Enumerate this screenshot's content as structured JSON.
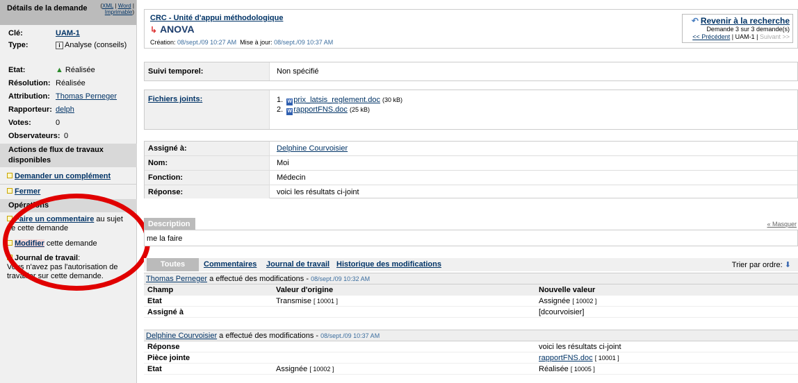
{
  "sidebar": {
    "title": "Détails de la demande",
    "formats": {
      "xml": "XML",
      "word": "Word",
      "printable": "Imprimable"
    },
    "fields": [
      {
        "key": "Clé:",
        "value": "UAM-1"
      },
      {
        "key": "Type:",
        "value": "Analyse (conseils)"
      },
      {
        "key": "Etat:",
        "value": "Réalisée"
      },
      {
        "key": "Résolution:",
        "value": "Réalisée"
      },
      {
        "key": "Attribution:",
        "value": "Thomas Perneger"
      },
      {
        "key": "Rapporteur:",
        "value": "delph"
      },
      {
        "key": "Votes:",
        "value": "0"
      },
      {
        "key": "Observateurs:",
        "value": "0"
      }
    ],
    "workflow_title": "Actions de flux de travaux disponibles",
    "workflow_actions": [
      "Demander un complément",
      "Fermer"
    ],
    "operations_title": "Opérations",
    "comment_link": "Faire un commentaire",
    "comment_suffix": "au sujet de cette demande",
    "modify_link": "Modifier",
    "modify_suffix": "cette demande",
    "journal_title": "Journal de travail",
    "journal_text": "Vous n'avez pas l'autorisation de travailler sur cette demande."
  },
  "header": {
    "project": "CRC - Unité d'appui méthodologique",
    "issue_title": "ANOVA",
    "created_label": "Création:",
    "created": "08/sept./09 10:27 AM",
    "updated_label": "Mise à jour:",
    "updated": "08/sept./09 10:37 AM",
    "back_label": "Revenir à la recherche",
    "position": "Demande 3 sur 3 demande(s)",
    "prev": "<< Précédent",
    "current": "UAM-1",
    "next": "Suivant >>"
  },
  "suivi": {
    "label": "Suivi temporel:",
    "value": "Non spécifié"
  },
  "attachments": {
    "label": "Fichiers joints:",
    "files": [
      {
        "num": "1.",
        "name": "prix_latsis_reglement.doc",
        "size": "(30 kB)"
      },
      {
        "num": "2.",
        "name": "rapportFNS.doc",
        "size": "(25 kB)"
      }
    ]
  },
  "custom_fields": [
    {
      "label": "Assigné à:",
      "value": "Delphine Courvoisier",
      "link": true
    },
    {
      "label": "Nom:",
      "value": "Moi",
      "link": false
    },
    {
      "label": "Fonction:",
      "value": "Médecin",
      "link": false
    },
    {
      "label": "Réponse:",
      "value": "voici les résultats ci-joint",
      "link": false
    }
  ],
  "description": {
    "tab": "Description",
    "hide": "« Masquer",
    "text": "me la faire"
  },
  "tabs": {
    "all": "Toutes",
    "comments": "Commentaires",
    "worklog": "Journal de travail",
    "history": "Historique des modifications",
    "sort": "Trier par ordre:"
  },
  "history": {
    "columns": [
      "Champ",
      "Valeur d'origine",
      "Nouvelle valeur"
    ],
    "groups": [
      {
        "author": "Thomas Perneger",
        "action": "a effectué des modifications -",
        "date": "08/sept./09 10:32 AM",
        "rows": [
          {
            "field": "Etat",
            "old": "Transmise",
            "old_id": "[ 10001 ]",
            "new": "Assignée",
            "new_id": "[ 10002 ]"
          },
          {
            "field": "Assigné à",
            "old": "",
            "old_id": "",
            "new": "[dcourvoisier]",
            "new_id": ""
          }
        ]
      },
      {
        "author": "Delphine Courvoisier",
        "action": "a effectué des modifications -",
        "date": "08/sept./09 10:37 AM",
        "rows": [
          {
            "field": "Réponse",
            "old": "",
            "old_id": "",
            "new": "voici les résultats ci-joint",
            "new_id": ""
          },
          {
            "field": "Pièce jointe",
            "old": "",
            "old_id": "",
            "new": "rapportFNS.doc",
            "new_id": "[ 10001 ]"
          },
          {
            "field": "Etat",
            "old": "Assignée",
            "old_id": "[ 10002 ]",
            "new": "Réalisée",
            "new_id": "[ 10005 ]"
          }
        ]
      }
    ]
  },
  "colors": {
    "highlight_circle": "#e00000",
    "link": "#036",
    "label_bg": "#f0f0f0"
  }
}
